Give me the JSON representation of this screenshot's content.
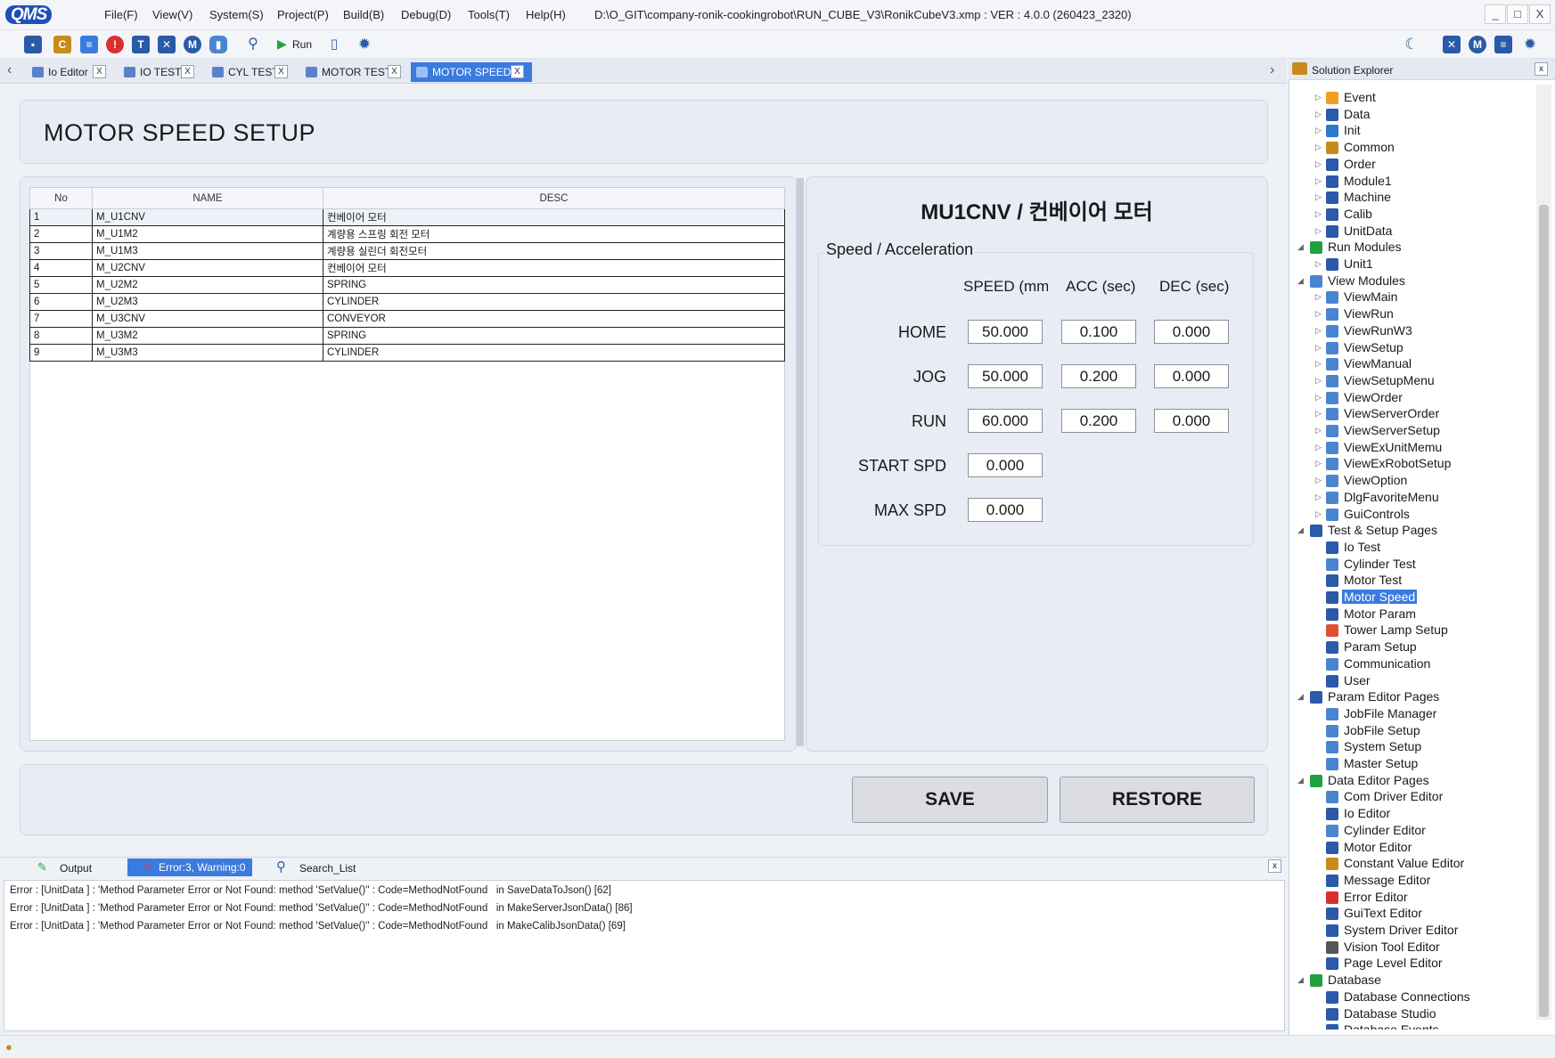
{
  "app": {
    "logo": "QMS",
    "menus": [
      "File(F)",
      "View(V)",
      "System(S)",
      "Project(P)",
      "Build(B)",
      "Debug(D)",
      "Tools(T)",
      "Help(H)"
    ],
    "title_path": "D:\\O_GIT\\company-ronik-cookingrobot\\RUN_CUBE_V3\\RonikCubeV3.xmp :  VER : 4.0.0 (260423_2320)",
    "window_buttons": [
      "_",
      "□",
      "X"
    ]
  },
  "toolbar": {
    "run_label": "Run",
    "icons": [
      "save-icon",
      "constant-icon",
      "message-icon",
      "error-icon",
      "guitext-icon",
      "io-icon",
      "motor-icon",
      "database-icon",
      "search-icon",
      "run-icon",
      "page-icon",
      "gear-icon",
      "moon-icon",
      "io-icon",
      "motor-icon",
      "page-icon",
      "gear-icon"
    ]
  },
  "tabs": [
    {
      "label": "Io Editor",
      "close": "X"
    },
    {
      "label": "IO TEST",
      "close": "X"
    },
    {
      "label": "CYL TEST",
      "close": "X"
    },
    {
      "label": "MOTOR TEST",
      "close": "X"
    },
    {
      "label": "MOTOR SPEED",
      "close": "X",
      "active": true
    }
  ],
  "page": {
    "title": "MOTOR SPEED SETUP",
    "table": {
      "headers": [
        "No",
        "NAME",
        "DESC"
      ],
      "rows": [
        [
          "1",
          "M_U1CNV",
          "컨베이어 모터"
        ],
        [
          "2",
          "M_U1M2",
          "계량용 스프링 회전 모터"
        ],
        [
          "3",
          "M_U1M3",
          "계량용 실린더 회전모터"
        ],
        [
          "4",
          "M_U2CNV",
          "컨베이어 모터"
        ],
        [
          "5",
          "M_U2M2",
          "SPRING"
        ],
        [
          "6",
          "M_U2M3",
          "CYLINDER"
        ],
        [
          "7",
          "M_U3CNV",
          "CONVEYOR"
        ],
        [
          "8",
          "M_U3M2",
          "SPRING"
        ],
        [
          "9",
          "M_U3M3",
          "CYLINDER"
        ]
      ]
    },
    "motor_title": "MU1CNV / 컨베이어 모터",
    "group_label": "Speed / Acceleration",
    "columns": [
      "SPEED (mm/",
      "ACC (sec)",
      "DEC (sec)"
    ],
    "rows": [
      {
        "label": "HOME",
        "speed": "50.000",
        "acc": "0.100",
        "dec": "0.000"
      },
      {
        "label": "JOG",
        "speed": "50.000",
        "acc": "0.200",
        "dec": "0.000"
      },
      {
        "label": "RUN",
        "speed": "60.000",
        "acc": "0.200",
        "dec": "0.000"
      },
      {
        "label": "START SPD",
        "speed": "0.000"
      },
      {
        "label": "MAX SPD",
        "speed": "0.000"
      }
    ],
    "save_label": "SAVE",
    "restore_label": "RESTORE"
  },
  "output": {
    "tabs": [
      "Output",
      "Error:3, Warning:0",
      "Search_List"
    ],
    "close": "x",
    "lines": [
      {
        "prefix": "Error : [UnitData      ]",
        "msg": ": 'Method Parameter Error or Not Found: method 'SetValue()'' : Code=MethodNotFound",
        "loc": "in SaveDataToJson() [62]"
      },
      {
        "prefix": "Error : [UnitData      ]",
        "msg": ": 'Method Parameter Error or Not Found: method 'SetValue()'' : Code=MethodNotFound",
        "loc": "in MakeServerJsonData() [86]"
      },
      {
        "prefix": "Error : [UnitData      ]",
        "msg": ": 'Method Parameter Error or Not Found: method 'SetValue()'' : Code=MethodNotFound",
        "loc": "in MakeCalibJsonData() [69]"
      }
    ]
  },
  "solution_explorer": {
    "title": "Solution Explorer",
    "close": "x",
    "items": [
      {
        "label": "Event",
        "level": 1,
        "icon": "event-icon"
      },
      {
        "label": "Data",
        "level": 1,
        "icon": "list-icon"
      },
      {
        "label": "Init",
        "level": 1,
        "icon": "init-icon"
      },
      {
        "label": "Common",
        "level": 1,
        "icon": "book-icon"
      },
      {
        "label": "Order",
        "level": 1,
        "icon": "list-icon"
      },
      {
        "label": "Module1",
        "level": 1,
        "icon": "list-icon"
      },
      {
        "label": "Machine",
        "level": 1,
        "icon": "list-icon"
      },
      {
        "label": "Calib",
        "level": 1,
        "icon": "list-icon"
      },
      {
        "label": "UnitData",
        "level": 1,
        "icon": "list-icon"
      },
      {
        "label": "Run Modules",
        "level": 0,
        "icon": "check-icon"
      },
      {
        "label": "Unit1",
        "level": 1,
        "icon": "list-icon"
      },
      {
        "label": "View Modules",
        "level": 0,
        "icon": "window-icon"
      },
      {
        "label": "ViewMain",
        "level": 1,
        "icon": "window-icon"
      },
      {
        "label": "ViewRun",
        "level": 1,
        "icon": "window-icon"
      },
      {
        "label": "ViewRunW3",
        "level": 1,
        "icon": "window-icon"
      },
      {
        "label": "ViewSetup",
        "level": 1,
        "icon": "window-icon"
      },
      {
        "label": "ViewManual",
        "level": 1,
        "icon": "window-icon"
      },
      {
        "label": "ViewSetupMenu",
        "level": 1,
        "icon": "window-icon"
      },
      {
        "label": "ViewOrder",
        "level": 1,
        "icon": "window-icon"
      },
      {
        "label": "ViewServerOrder",
        "level": 1,
        "icon": "window-icon"
      },
      {
        "label": "ViewServerSetup",
        "level": 1,
        "icon": "window-icon"
      },
      {
        "label": "ViewExUnitMemu",
        "level": 1,
        "icon": "window-icon"
      },
      {
        "label": "ViewExRobotSetup",
        "level": 1,
        "icon": "window-icon"
      },
      {
        "label": "ViewOption",
        "level": 1,
        "icon": "window-icon"
      },
      {
        "label": "DlgFavoriteMenu",
        "level": 1,
        "icon": "window-icon"
      },
      {
        "label": "GuiControls",
        "level": 1,
        "icon": "window-icon"
      },
      {
        "label": "Test & Setup Pages",
        "level": 0,
        "icon": "list-icon"
      },
      {
        "label": "Io Test",
        "level": 2,
        "icon": "io-test-icon"
      },
      {
        "label": "Cylinder Test",
        "level": 2,
        "icon": "cylinder-icon"
      },
      {
        "label": "Motor Test",
        "level": 2,
        "icon": "motor-test-icon"
      },
      {
        "label": "Motor Speed",
        "level": 2,
        "icon": "gauge-icon",
        "selected": true
      },
      {
        "label": "Motor Param",
        "level": 2,
        "icon": "clock-icon"
      },
      {
        "label": "Tower Lamp Setup",
        "level": 2,
        "icon": "lamp-icon"
      },
      {
        "label": "Param Setup",
        "level": 2,
        "icon": "list-icon"
      },
      {
        "label": "Communication",
        "level": 2,
        "icon": "link-icon"
      },
      {
        "label": "User",
        "level": 2,
        "icon": "user-icon"
      },
      {
        "label": "Param Editor Pages",
        "level": 0,
        "icon": "list-icon"
      },
      {
        "label": "JobFile Manager",
        "level": 2,
        "icon": "page-icon"
      },
      {
        "label": "JobFile Setup",
        "level": 2,
        "icon": "page-icon"
      },
      {
        "label": "System Setup",
        "level": 2,
        "icon": "page-icon"
      },
      {
        "label": "Master Setup",
        "level": 2,
        "icon": "page-icon"
      },
      {
        "label": "Data Editor Pages",
        "level": 0,
        "icon": "check-icon"
      },
      {
        "label": "Com Driver Editor",
        "level": 2,
        "icon": "link-icon"
      },
      {
        "label": "Io Editor",
        "level": 2,
        "icon": "io-icon"
      },
      {
        "label": "Cylinder Editor",
        "level": 2,
        "icon": "cylinder-icon"
      },
      {
        "label": "Motor Editor",
        "level": 2,
        "icon": "motor-icon"
      },
      {
        "label": "Constant Value Editor",
        "level": 2,
        "icon": "constant-icon"
      },
      {
        "label": "Message Editor",
        "level": 2,
        "icon": "message-icon"
      },
      {
        "label": "Error Editor",
        "level": 2,
        "icon": "error-icon"
      },
      {
        "label": "GuiText Editor",
        "level": 2,
        "icon": "guitext-icon"
      },
      {
        "label": "System Driver Editor",
        "level": 2,
        "icon": "gear-icon"
      },
      {
        "label": "Vision Tool Editor",
        "level": 2,
        "icon": "camera-icon"
      },
      {
        "label": "Page Level Editor",
        "level": 2,
        "icon": "user-icon"
      },
      {
        "label": "Database",
        "level": 0,
        "icon": "check-icon"
      },
      {
        "label": "Database Connections",
        "level": 2,
        "icon": "cube-icon"
      },
      {
        "label": "Database Studio",
        "level": 2,
        "icon": "cube-icon"
      },
      {
        "label": "Database Events",
        "level": 2,
        "icon": "cube-icon"
      }
    ]
  },
  "colors": {
    "accent": "#3a7be0",
    "selected": "#3a7be0",
    "error_tab": "#3a7be0"
  }
}
